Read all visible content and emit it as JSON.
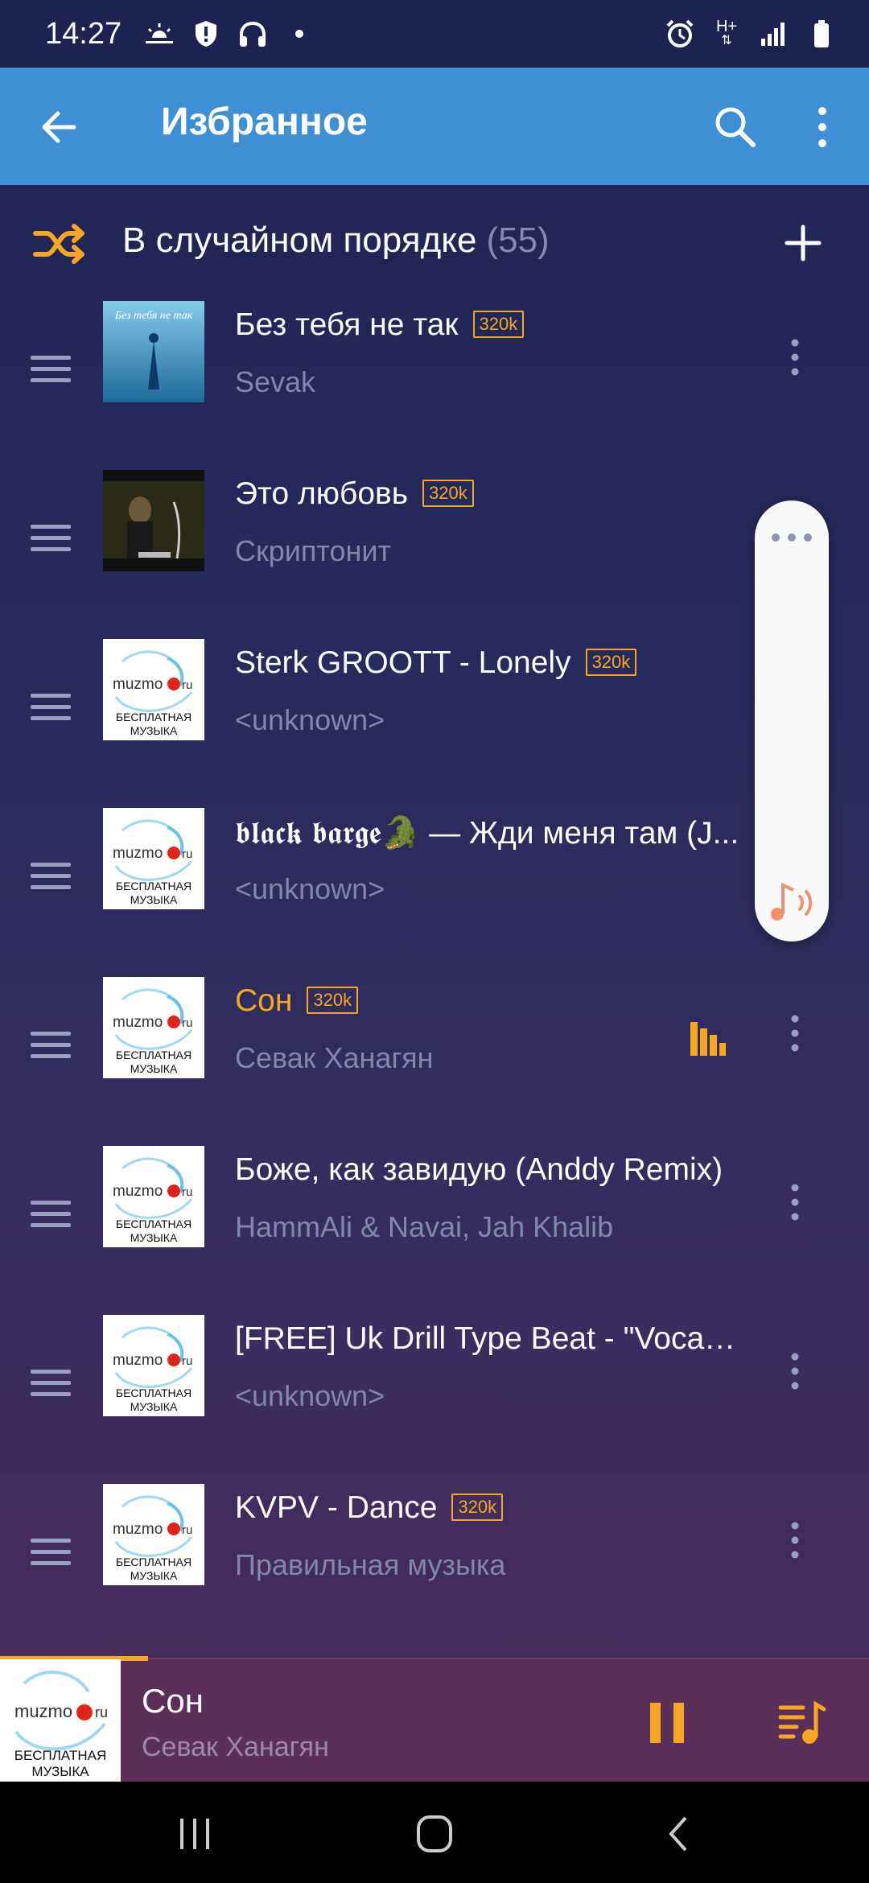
{
  "status": {
    "time": "14:27",
    "network": "H+"
  },
  "appbar": {
    "title": "Избранное"
  },
  "shuffle": {
    "label": "В случайном порядке",
    "count": "(55)"
  },
  "cover": {
    "brand_a": "muzmo",
    "brand_b": "ru",
    "caption_1": "БЕСПЛАТНАЯ",
    "caption_2": "МУЗЫКА"
  },
  "tracks": [
    {
      "title": "Без тебя не так",
      "artist": "Sevak",
      "badge": "320k",
      "cover": "sevak",
      "active": false,
      "cover_text": "Без тебя не так"
    },
    {
      "title": "Это любовь",
      "artist": "Скриптонит",
      "badge": "320k",
      "cover": "skript",
      "active": false
    },
    {
      "title": "Sterk GROOTT - Lonely",
      "artist": "<unknown>",
      "badge": "320k",
      "cover": "muzmo",
      "active": false
    },
    {
      "title": "𝖇𝖑𝖆𝖈𝖐 𝖇𝖆𝖗𝖌𝖊🐊 — Жди меня там (J...",
      "artist": "<unknown>",
      "badge": "",
      "cover": "muzmo",
      "active": false
    },
    {
      "title": "Сон",
      "artist": "Севак Ханагян",
      "badge": "320k",
      "cover": "muzmo",
      "active": true
    },
    {
      "title": "Боже, как завидую (Anddy Remix)",
      "artist": "HammAli & Navai, Jah Khalib",
      "badge": "",
      "cover": "muzmo",
      "active": false
    },
    {
      "title": "[FREE] Uk Drill Type Beat - \"Vocal ...",
      "artist": "<unknown>",
      "badge": "",
      "cover": "muzmo",
      "active": false
    },
    {
      "title": "KVPV - Dance",
      "artist": "Правильная музыка",
      "badge": "320k",
      "cover": "muzmo",
      "active": false
    }
  ],
  "miniplayer": {
    "title": "Сон",
    "artist": "Севак Ханагян",
    "progress": 0.17
  },
  "colors": {
    "accent": "#f5a623",
    "appbar": "#3f8fd4",
    "statusbar": "#1d2351"
  }
}
